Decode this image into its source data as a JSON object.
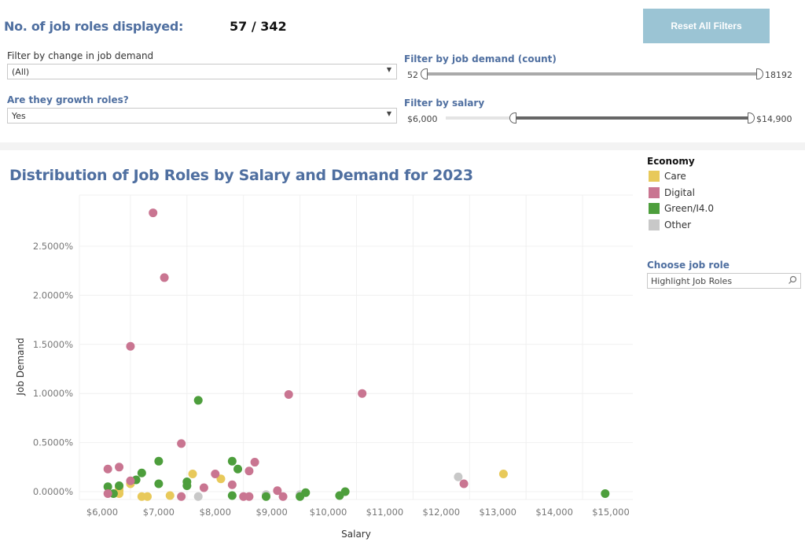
{
  "header": {
    "count_label": "No. of job roles displayed:",
    "count_value": "57 / 342",
    "reset_button": "Reset All Filters"
  },
  "filters": {
    "change_in_demand": {
      "label": "Filter by change in job demand",
      "value": "(All)"
    },
    "growth_roles": {
      "label": "Are they growth roles?",
      "value": "Yes"
    },
    "job_demand_count": {
      "label": "Filter by job demand (count)",
      "min": "52",
      "max": "18192",
      "range_low": 0.0,
      "range_high": 1.0
    },
    "salary": {
      "label": "Filter by salary",
      "min": "$6,000",
      "max": "$14,900",
      "range_low": 0.2,
      "range_high": 1.0
    }
  },
  "legend": {
    "title": "Economy",
    "items": [
      {
        "label": "Care",
        "color": "#e8c95a"
      },
      {
        "label": "Digital",
        "color": "#c97591"
      },
      {
        "label": "Green/I4.0",
        "color": "#4d9e3c"
      },
      {
        "label": "Other",
        "color": "#c8c8c8"
      }
    ]
  },
  "job_role_search": {
    "label": "Choose job role",
    "placeholder": "Highlight Job Roles"
  },
  "chart_data": {
    "type": "scatter",
    "title": "Distribution of Job Roles by Salary and Demand for 2023",
    "xlabel": "Salary",
    "ylabel": "Job Demand",
    "xlim": [
      5700,
      15400
    ],
    "ylim": [
      -0.07,
      3.0
    ],
    "grid": true,
    "legend_position": "right",
    "x_ticks": [
      "$6,000",
      "$7,000",
      "$8,000",
      "$9,000",
      "$10,000",
      "$11,000",
      "$12,000",
      "$13,000",
      "$14,000",
      "$15,000"
    ],
    "x_tick_values": [
      6000,
      7000,
      8000,
      9000,
      10000,
      11000,
      12000,
      13000,
      14000,
      15000
    ],
    "y_ticks": [
      "0.0000%",
      "0.5000%",
      "1.0000%",
      "1.5000%",
      "2.0000%",
      "2.5000%"
    ],
    "y_tick_values": [
      0,
      0.5,
      1.0,
      1.5,
      2.0,
      2.5
    ],
    "series": [
      {
        "name": "Care",
        "color": "#e8c95a",
        "points": [
          [
            6300,
            0.04
          ],
          [
            6300,
            0.01
          ],
          [
            6300,
            -0.02
          ],
          [
            6500,
            0.08
          ],
          [
            6700,
            -0.05
          ],
          [
            6800,
            -0.05
          ],
          [
            7200,
            -0.04
          ],
          [
            7600,
            0.18
          ],
          [
            8100,
            0.13
          ],
          [
            13100,
            0.18
          ]
        ]
      },
      {
        "name": "Digital",
        "color": "#c97591",
        "points": [
          [
            6900,
            2.84
          ],
          [
            7100,
            2.18
          ],
          [
            6500,
            1.48
          ],
          [
            9300,
            0.99
          ],
          [
            10600,
            1.0
          ],
          [
            7400,
            0.49
          ],
          [
            6100,
            0.23
          ],
          [
            6300,
            0.25
          ],
          [
            6100,
            -0.02
          ],
          [
            6500,
            0.11
          ],
          [
            7400,
            -0.05
          ],
          [
            7800,
            0.04
          ],
          [
            8000,
            0.18
          ],
          [
            8300,
            0.07
          ],
          [
            8500,
            -0.05
          ],
          [
            8600,
            0.21
          ],
          [
            8600,
            -0.05
          ],
          [
            8700,
            0.3
          ],
          [
            9100,
            0.01
          ],
          [
            9200,
            -0.05
          ],
          [
            12400,
            0.08
          ]
        ]
      },
      {
        "name": "Green/I4.0",
        "color": "#4d9e3c",
        "points": [
          [
            7700,
            0.93
          ],
          [
            7000,
            0.31
          ],
          [
            6700,
            0.19
          ],
          [
            6600,
            0.12
          ],
          [
            6100,
            0.05
          ],
          [
            6200,
            -0.02
          ],
          [
            6300,
            0.06
          ],
          [
            7000,
            0.08
          ],
          [
            7500,
            0.1
          ],
          [
            7500,
            0.06
          ],
          [
            8300,
            0.31
          ],
          [
            8400,
            0.23
          ],
          [
            8300,
            -0.04
          ],
          [
            8900,
            -0.05
          ],
          [
            9500,
            -0.05
          ],
          [
            9600,
            -0.01
          ],
          [
            10200,
            -0.04
          ],
          [
            10300,
            0.0
          ],
          [
            14900,
            -0.02
          ]
        ]
      },
      {
        "name": "Other",
        "color": "#c8c8c8",
        "points": [
          [
            7700,
            -0.05
          ],
          [
            8900,
            -0.03
          ],
          [
            9500,
            -0.03
          ],
          [
            12300,
            0.15
          ]
        ]
      }
    ]
  }
}
